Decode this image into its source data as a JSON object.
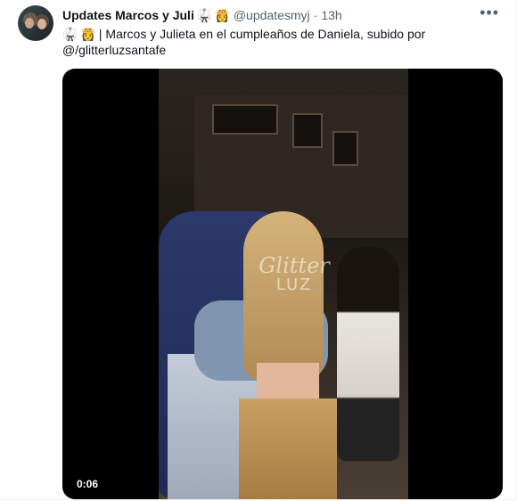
{
  "tweet": {
    "author_name": "Updates Marcos y Juli",
    "author_emojis": [
      "🥋",
      "👸"
    ],
    "handle": "@updatesmyj",
    "separator": "·",
    "time": "13h",
    "more_icon": "more-dots-icon",
    "text_emojis": [
      "🥋",
      "👸"
    ],
    "text_line1": "| Marcos y Julieta en el cumpleaños de Daniela, subido por",
    "text_line2": "@/glitterluzsantafe"
  },
  "media": {
    "type": "video",
    "duration": "0:06",
    "watermark_line1": "Glitter",
    "watermark_line2": "LUZ"
  }
}
